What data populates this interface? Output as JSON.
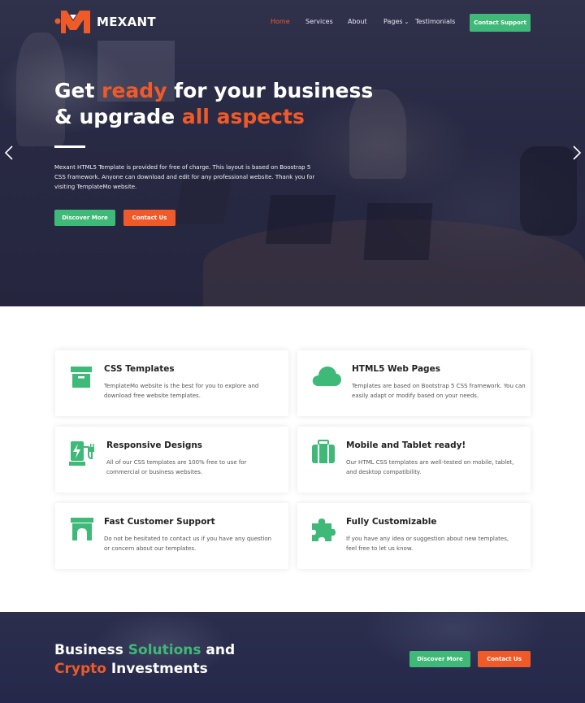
{
  "brand": {
    "name": "MEXANT",
    "accent_orange": "#f05a28",
    "accent_green": "#3fb977"
  },
  "nav": {
    "items": [
      {
        "label": "Home",
        "active": true
      },
      {
        "label": "Services"
      },
      {
        "label": "About"
      },
      {
        "label": "Pages",
        "has_dropdown": true
      },
      {
        "label": "Testimonials"
      }
    ],
    "support_button": "Contact Support"
  },
  "hero": {
    "title_line1_part1": "Get ",
    "title_line1_highlight": "ready",
    "title_line1_part2": " for your business",
    "title_line2_part1": "& upgrade ",
    "title_line2_highlight": "all aspects",
    "description": "Mexant HTML5 Template is provided for free of charge. This layout is based on Boostrap 5 CSS framework. Anyone can download and edit for any professional website. Thank you for visiting TemplateMo website.",
    "primary_button": "Discover More",
    "secondary_button": "Contact Us",
    "prev_icon": "chevron-left-icon",
    "next_icon": "chevron-right-icon"
  },
  "features": [
    {
      "title": "CSS Templates",
      "text": "TemplateMo website is the best for you to explore and download free website templates.",
      "icon": "archive-box-icon"
    },
    {
      "title": "HTML5 Web Pages",
      "text": "Templates are based on Bootstrap 5 CSS framework. You can easily adapt or modify based on your needs.",
      "icon": "cloud-icon"
    },
    {
      "title": "Responsive Designs",
      "text": "All of our CSS templates are 100% free to use for commercial or business websites.",
      "icon": "charging-station-icon"
    },
    {
      "title": "Mobile and Tablet ready!",
      "text": "Our HTML CSS templates are well-tested on mobile, tablet, and desktop compatibility.",
      "icon": "suitcase-icon"
    },
    {
      "title": "Fast Customer Support",
      "text": "Do not be hesitated to contact us if you have any question or concern about our templates.",
      "icon": "archway-icon"
    },
    {
      "title": "Fully Customizable",
      "text": "If you have any idea or suggestion about new templates, feel free to let us know.",
      "icon": "puzzle-piece-icon"
    }
  ],
  "banner": {
    "line1_part1": "Business ",
    "line1_highlight": "Solutions",
    "line1_part2": " and",
    "line2_highlight": "Crypto",
    "line2_part2": " Investments",
    "primary_button": "Discover More",
    "secondary_button": "Contact Us"
  }
}
